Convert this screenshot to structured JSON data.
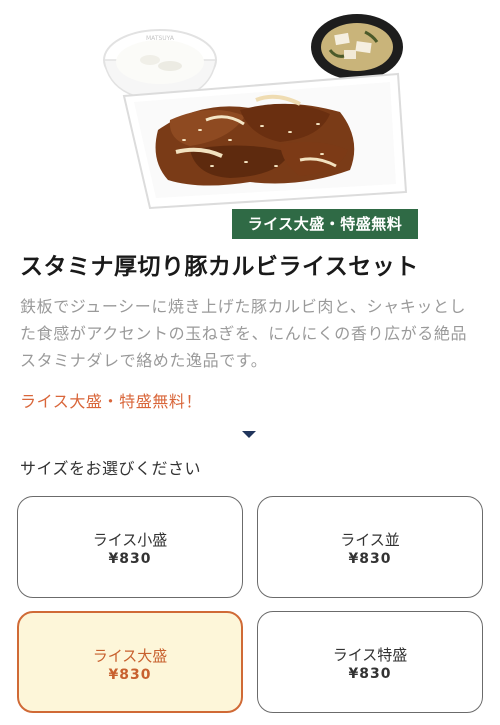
{
  "product": {
    "badge": "ライス大盛・特盛無料",
    "title": "スタミナ厚切り豚カルビライスセット",
    "description": "鉄板でジューシーに焼き上げた豚カルビ肉と、シャキッとした食感がアクセントの玉ねぎを、にんにくの香り広がる絶品スタミナダレで絡めた逸品です。",
    "promo": "ライス大盛・特盛無料！",
    "bowl_logo": "MATSUYA"
  },
  "size_select": {
    "heading": "サイズをお選びください",
    "options": [
      {
        "label": "ライス小盛",
        "price": "¥830",
        "selected": false
      },
      {
        "label": "ライス並",
        "price": "¥830",
        "selected": false
      },
      {
        "label": "ライス大盛",
        "price": "¥830",
        "selected": true
      },
      {
        "label": "ライス特盛",
        "price": "¥830",
        "selected": false
      }
    ]
  },
  "colors": {
    "badge_bg": "#2f6a45",
    "accent": "#d9663a",
    "selected_bg": "#fdf6d9",
    "chevron": "#21355c"
  },
  "icons": {
    "expand": "chevron-down-icon"
  }
}
